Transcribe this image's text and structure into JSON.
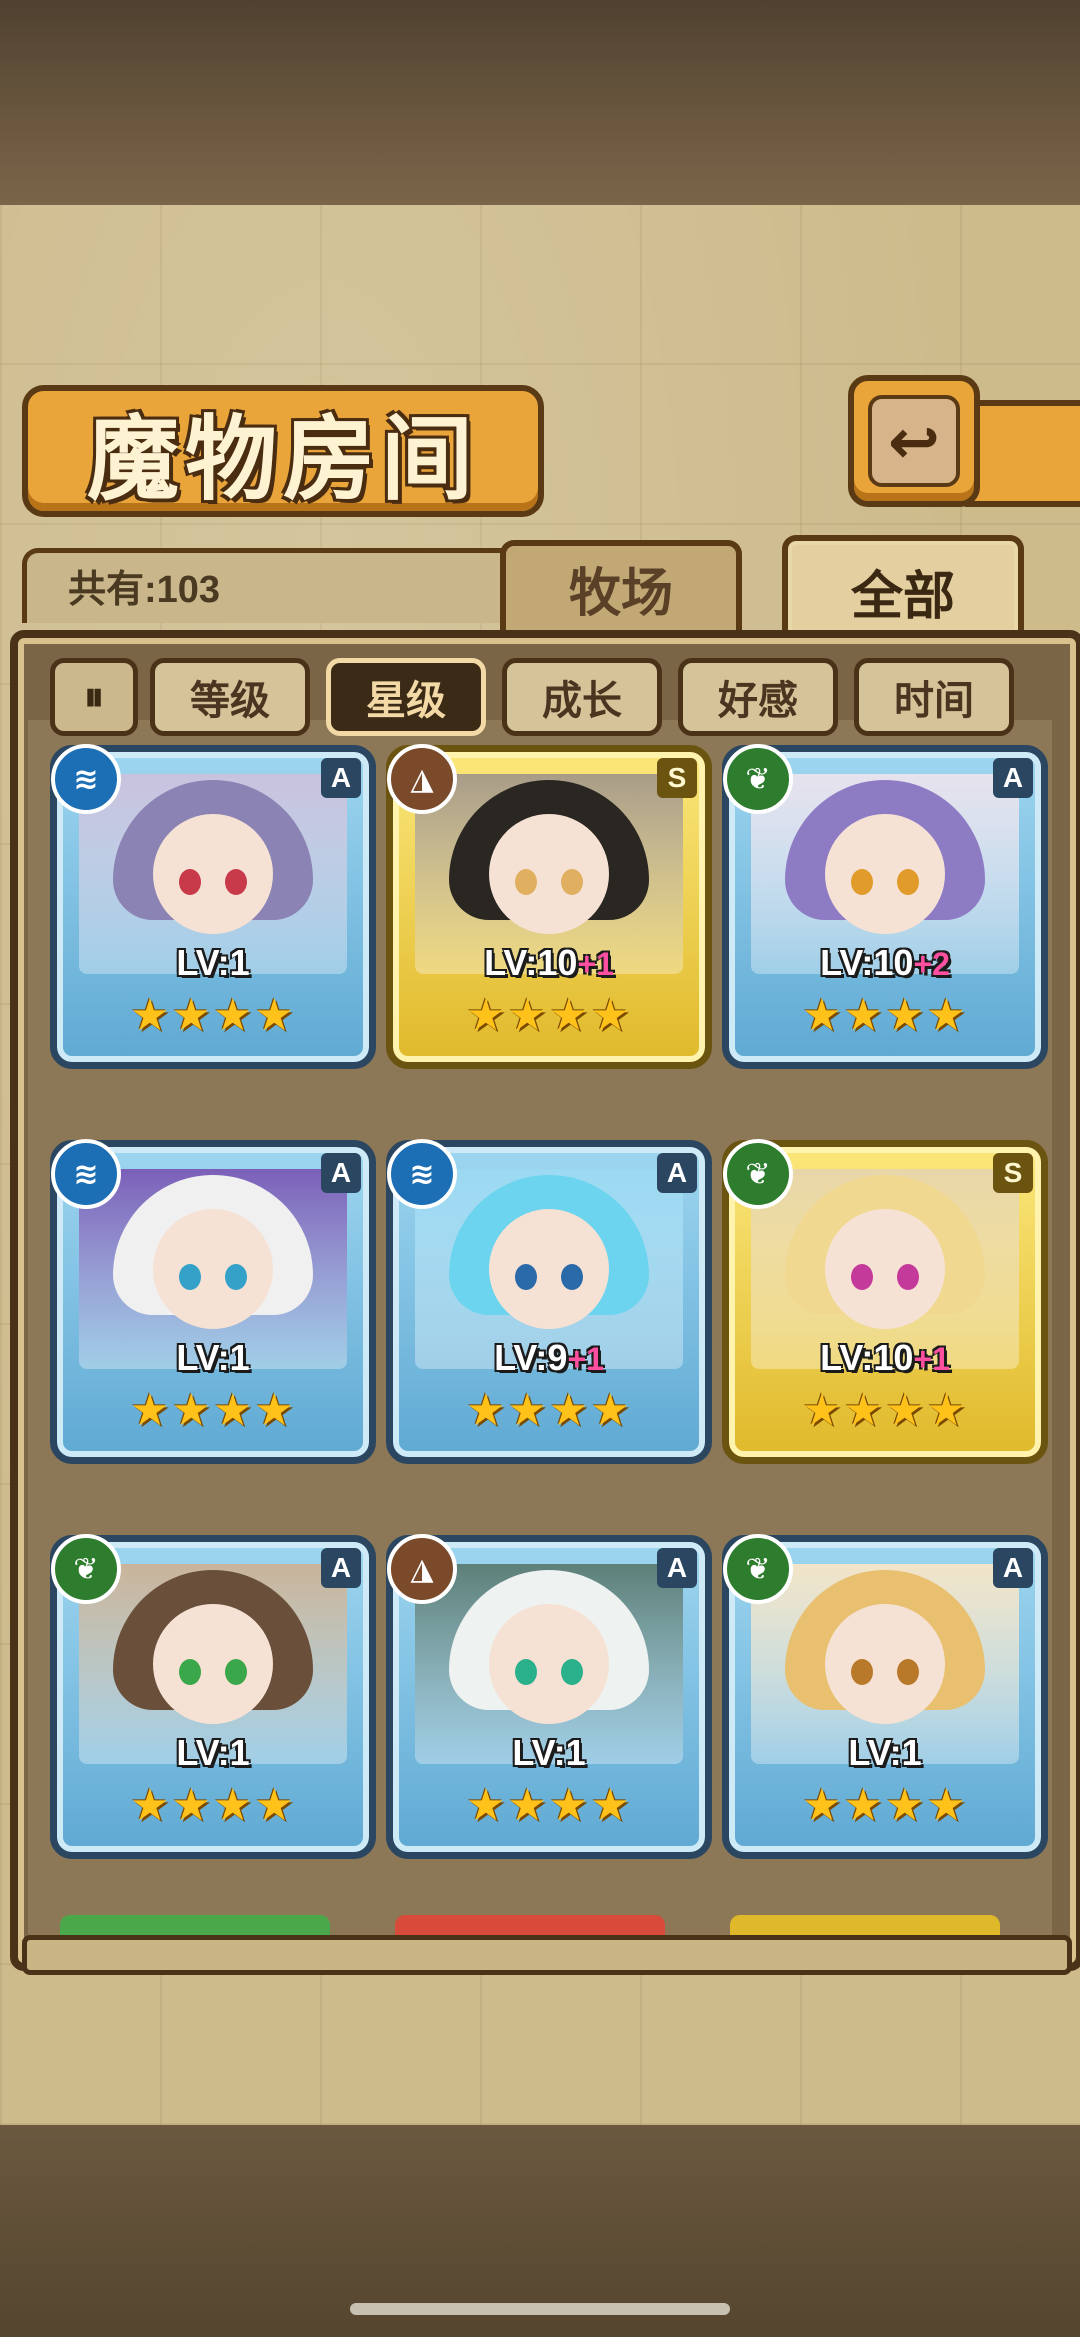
{
  "title": "魔物房间",
  "back_icon": "back-arrow-icon",
  "count_label": "共有:103",
  "tabs": [
    {
      "label": "牧场",
      "active": false
    },
    {
      "label": "全部",
      "active": true
    }
  ],
  "sort_toggle_icon": "pause-sort-icon",
  "sort_buttons": [
    {
      "label": "等级",
      "active": false
    },
    {
      "label": "星级",
      "active": true
    },
    {
      "label": "成长",
      "active": false
    },
    {
      "label": "好感",
      "active": false
    },
    {
      "label": "时间",
      "active": false
    }
  ],
  "cards": [
    {
      "element": "water",
      "rank": "A",
      "frame": "blue",
      "level": "LV:1",
      "bonus": "",
      "stars": 4,
      "hair": "#8a83b3",
      "eye": "#c83a4a",
      "bg": "#c9c2de"
    },
    {
      "element": "earth",
      "rank": "S",
      "frame": "gold",
      "level": "LV:10",
      "bonus": "+1",
      "stars": 4,
      "hair": "#2a2622",
      "eye": "#e0b060",
      "bg": "#a89c88"
    },
    {
      "element": "wood",
      "rank": "A",
      "frame": "blue",
      "level": "LV:10",
      "bonus": "+2",
      "stars": 4,
      "hair": "#8d7bc4",
      "eye": "#e09b2a",
      "bg": "#e6e2ee"
    },
    {
      "element": "water",
      "rank": "A",
      "frame": "blue",
      "level": "LV:1",
      "bonus": "",
      "stars": 4,
      "hair": "#f0f0f0",
      "eye": "#34a2c8",
      "bg": "#7b5fb8"
    },
    {
      "element": "water",
      "rank": "A",
      "frame": "blue",
      "level": "LV:9",
      "bonus": "+1",
      "stars": 4,
      "hair": "#6cd4ee",
      "eye": "#2a6aa8",
      "bg": "#9bd9f2"
    },
    {
      "element": "wood",
      "rank": "S",
      "frame": "gold",
      "level": "LV:10",
      "bonus": "+1",
      "stars": 4,
      "hair": "#f0d890",
      "eye": "#c43a9a",
      "bg": "#e8d6a8"
    },
    {
      "element": "wood",
      "rank": "A",
      "frame": "blue",
      "level": "LV:1",
      "bonus": "",
      "stars": 4,
      "hair": "#6a4f3a",
      "eye": "#3aa84a",
      "bg": "#c9b49a"
    },
    {
      "element": "earth",
      "rank": "A",
      "frame": "blue",
      "level": "LV:1",
      "bonus": "",
      "stars": 4,
      "hair": "#eef2f0",
      "eye": "#2ab08a",
      "bg": "#5c7f78"
    },
    {
      "element": "wood",
      "rank": "A",
      "frame": "blue",
      "level": "LV:1",
      "bonus": "",
      "stars": 4,
      "hair": "#e8c070",
      "eye": "#b87a2a",
      "bg": "#f2e4c8"
    }
  ]
}
